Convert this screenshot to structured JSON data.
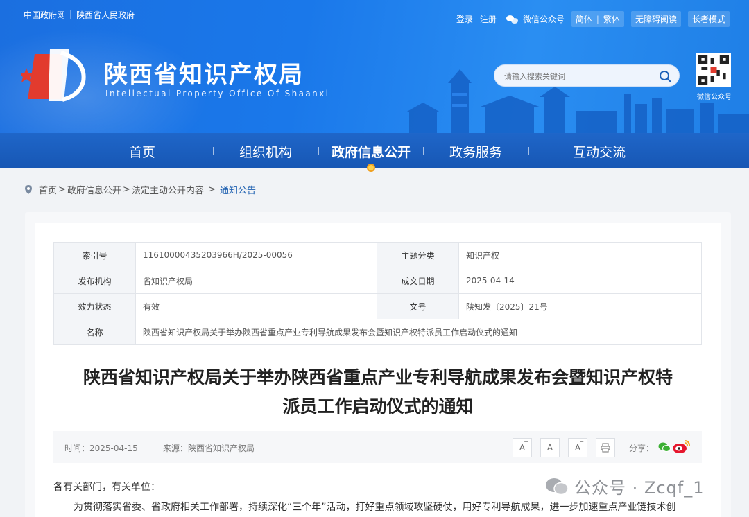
{
  "top": {
    "left_links": [
      "中国政府网",
      "陕西省人民政府"
    ],
    "login": "登录",
    "register": "注册",
    "wechat": "微信公众号",
    "simplified": "简体",
    "traditional": "繁体",
    "accessible": "无障碍阅读",
    "elder": "长者模式"
  },
  "site": {
    "title": "陕西省知识产权局",
    "subtitle": "Intellectual Property Office Of Shaanxi",
    "qr_label": "微信公众号"
  },
  "search": {
    "placeholder": "请输入搜索关键词"
  },
  "nav": [
    "首页",
    "组织机构",
    "政府信息公开",
    "政务服务",
    "互动交流"
  ],
  "nav_active": 2,
  "breadcrumb": {
    "items": [
      "首页",
      "政府信息公开",
      "法定主动公开内容"
    ],
    "current": "通知公告"
  },
  "meta": {
    "index_label": "索引号",
    "index_value": "11610000435203966H/2025-00056",
    "topic_label": "主题分类",
    "topic_value": "知识产权",
    "org_label": "发布机构",
    "org_value": "省知识产权局",
    "date_label": "成文日期",
    "date_value": "2025-04-14",
    "status_label": "效力状态",
    "status_value": "有效",
    "docno_label": "文号",
    "docno_value": "陕知发〔2025〕21号",
    "name_label": "名称",
    "name_value": "陕西省知识产权局关于举办陕西省重点产业专利导航成果发布会暨知识产权特派员工作启动仪式的通知"
  },
  "doc": {
    "title_line1": "陕西省知识产权局关于举办陕西省重点产业专利导航成果发布会暨知识产权特",
    "title_line2": "派员工作启动仪式的通知",
    "time": "时间：2025-04-15",
    "source": "来源：陕西省知识产权局",
    "font_inc": "A",
    "font_normal": "A",
    "font_dec": "A",
    "share": "分享：",
    "greeting": "各有关部门，有关单位：",
    "para1": "为贯彻落实省委、省政府相关工作部署，持续深化“三个年”活动，打好重点领域攻坚硬仗，用好专利导航成果，进一步加速重点产业链技术创"
  },
  "watermark": "公众号 · Zcqf_1"
}
